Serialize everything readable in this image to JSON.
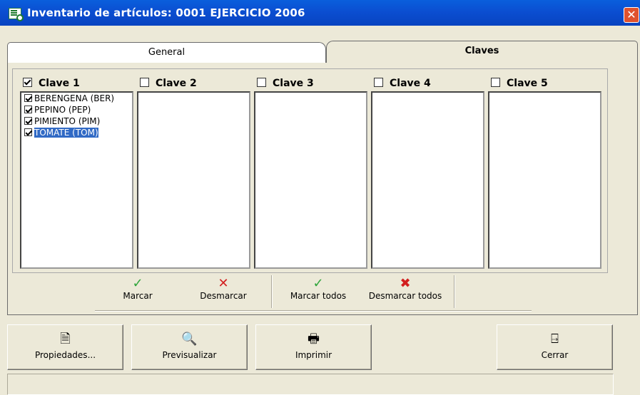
{
  "window": {
    "title": "Inventario de artículos: 0001 EJERCICIO 2006"
  },
  "tabs": [
    {
      "label": "General",
      "active": false
    },
    {
      "label": "Claves",
      "active": true
    }
  ],
  "claves": [
    {
      "label": "Clave 1",
      "checked": true,
      "items": [
        {
          "label": "BERENGENA (BER)",
          "checked": true,
          "selected": false
        },
        {
          "label": "PEPINO (PEP)",
          "checked": true,
          "selected": false
        },
        {
          "label": "PIMIENTO (PIM)",
          "checked": true,
          "selected": false
        },
        {
          "label": "TOMATE (TOM)",
          "checked": true,
          "selected": true
        }
      ]
    },
    {
      "label": "Clave 2",
      "checked": false,
      "items": []
    },
    {
      "label": "Clave 3",
      "checked": false,
      "items": []
    },
    {
      "label": "Clave 4",
      "checked": false,
      "items": []
    },
    {
      "label": "Clave 5",
      "checked": false,
      "items": []
    }
  ],
  "toolbar": {
    "marcar": "Marcar",
    "desmarcar": "Desmarcar",
    "marcar_todos": "Marcar todos",
    "desmarcar_todos": "Desmarcar todos"
  },
  "buttons": {
    "propiedades": "Propiedades...",
    "previsualizar": "Previsualizar",
    "imprimir": "Imprimir",
    "cerrar": "Cerrar"
  },
  "colors": {
    "titlebar": "#0b4ed1",
    "selection": "#316ac5",
    "check": "#2ea43a",
    "cross": "#d21f1f"
  }
}
